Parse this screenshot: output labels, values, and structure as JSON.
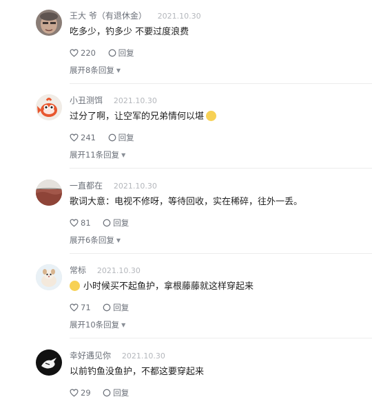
{
  "actions": {
    "reply_label": "回复"
  },
  "comments": [
    {
      "username": "王大 爷（有退休金）",
      "time": "2021.10.30",
      "text": "吃多少，钓多少 不要过度浪费",
      "likes": "220",
      "expand": "展开8条回复"
    },
    {
      "username": "小丑测饵",
      "time": "2021.10.30",
      "text": "过分了啊，让空军的兄弟情何以堪",
      "likes": "241",
      "expand": "展开11条回复"
    },
    {
      "username": "一直都在",
      "time": "2021.10.30",
      "text": "歌词大意：电视不修呀，等待回收，实在稀碎，往外一丢。",
      "likes": "81",
      "expand": "展开6条回复"
    },
    {
      "username": "常标",
      "time": "2021.10.30",
      "text": "小时候买不起鱼护，拿根藤藤就这样穿起来",
      "likes": "71",
      "expand": "展开10条回复"
    },
    {
      "username": "幸好遇见你",
      "time": "2021.10.30",
      "text": "以前钓鱼没鱼护，不都这要穿起来",
      "likes": "29"
    }
  ]
}
